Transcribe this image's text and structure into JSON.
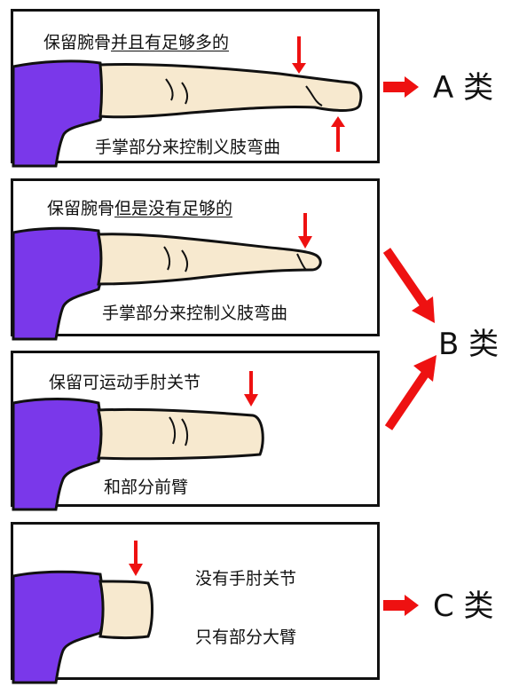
{
  "panels": [
    {
      "line1": {
        "prefix": "保留腕骨",
        "underlined": "并且有足够多的"
      },
      "line2": "手掌部分来控制义肢弯曲",
      "category": "A 类"
    },
    {
      "line1": {
        "prefix": "保留腕骨",
        "underlined": "但是没有足够的"
      },
      "line2": "手掌部分来控制义肢弯曲",
      "category": "B 类"
    },
    {
      "line1": "保留可运动手肘关节",
      "line2": "和部分前臂"
    },
    {
      "line1": "没有手肘关节",
      "line2": "只有部分大臂",
      "category": "C 类"
    }
  ],
  "colors": {
    "sleeve": "#7a38ea",
    "skin": "#f7e9cf",
    "arrow": "#ee1111",
    "outline": "#111111"
  }
}
